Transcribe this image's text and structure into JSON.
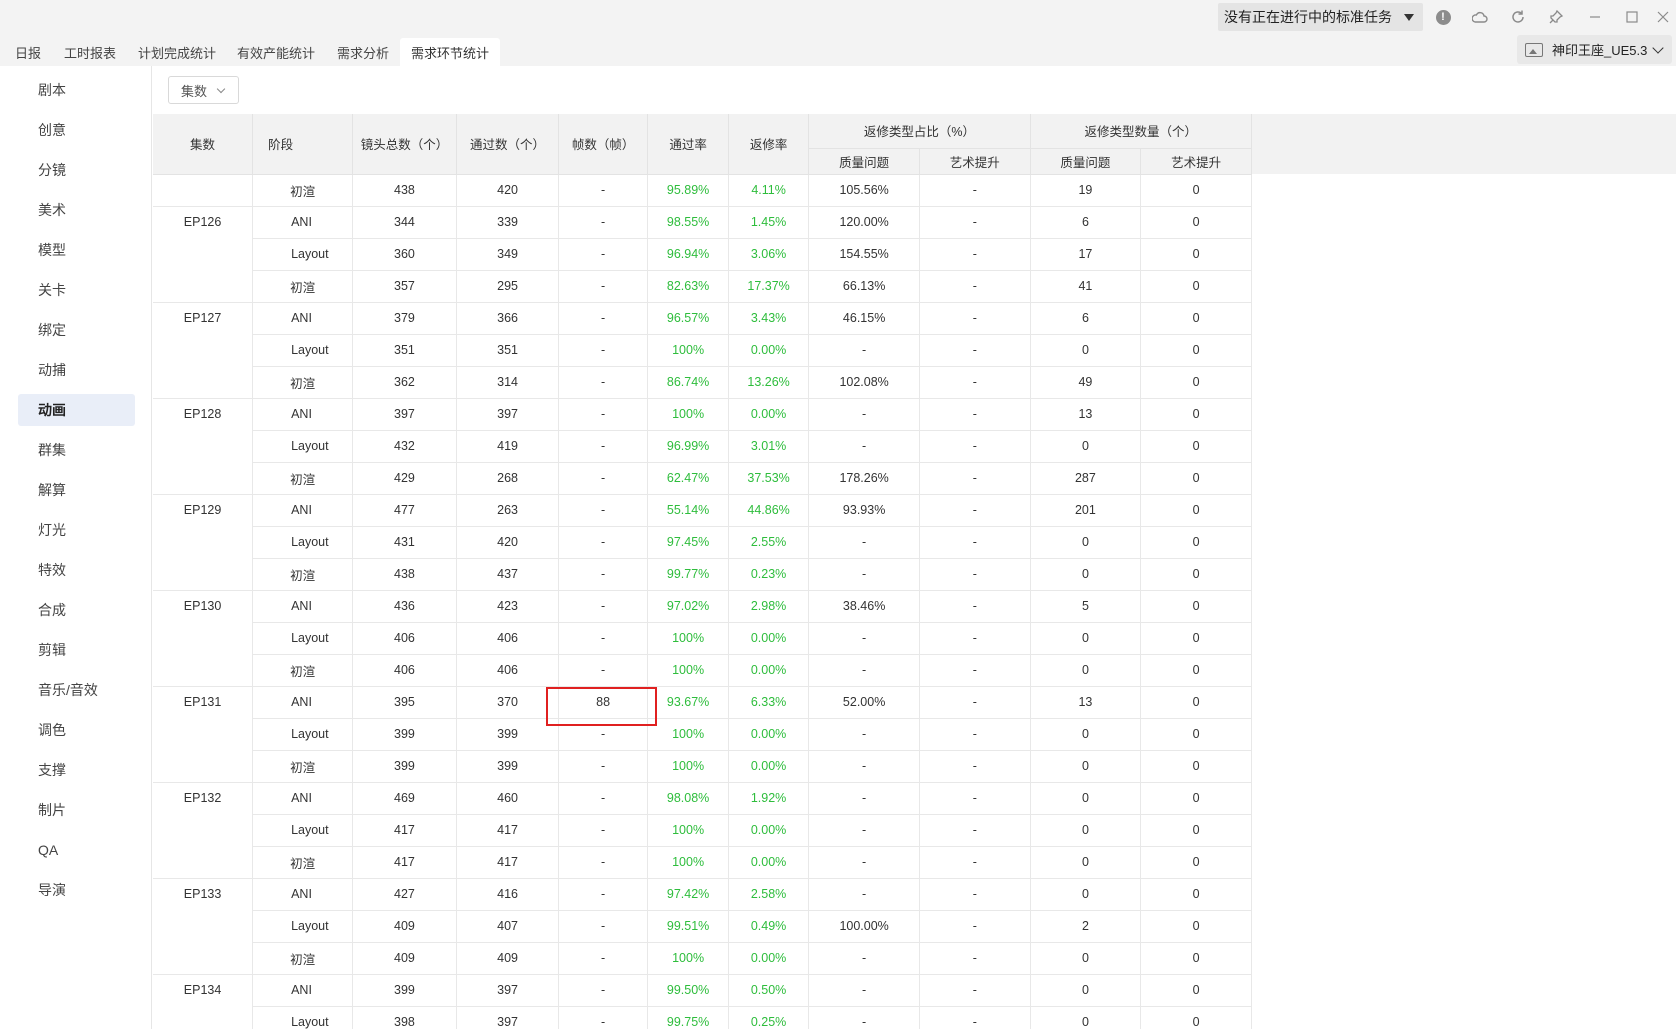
{
  "titlebar": {
    "task_dropdown": "没有正在进行中的标准任务"
  },
  "tabs": [
    {
      "label": "日报",
      "active": false
    },
    {
      "label": "工时报表",
      "active": false
    },
    {
      "label": "计划完成统计",
      "active": false
    },
    {
      "label": "有效产能统计",
      "active": false
    },
    {
      "label": "需求分析",
      "active": false
    },
    {
      "label": "需求环节统计",
      "active": true
    }
  ],
  "project": {
    "label": "神印王座_UE5.3"
  },
  "sidebar": {
    "items": [
      "剧本",
      "创意",
      "分镜",
      "美术",
      "模型",
      "关卡",
      "绑定",
      "动捕",
      "动画",
      "群集",
      "解算",
      "灯光",
      "特效",
      "合成",
      "剪辑",
      "音乐/音效",
      "调色",
      "支撑",
      "制片",
      "QA",
      "导演"
    ],
    "active": "动画"
  },
  "filter": {
    "label": "集数"
  },
  "table": {
    "headers": {
      "episode": "集数",
      "stage": "阶段",
      "total_shots": "镜头总数（个）",
      "passed": "通过数（个）",
      "frames": "帧数（帧）",
      "pass_rate": "通过率",
      "rework_rate": "返修率",
      "ratio_group": "返修类型占比（%）",
      "count_group": "返修类型数量（个）",
      "quality": "质量问题",
      "art": "艺术提升"
    },
    "rows": [
      {
        "ep": "",
        "stage": "初渲",
        "total": "438",
        "passed": "420",
        "frames": "-",
        "pass": "95.89%",
        "rework": "4.11%",
        "q_ratio": "105.56%",
        "a_ratio": "-",
        "q_cnt": "19",
        "a_cnt": "0"
      },
      {
        "ep": "EP126",
        "stage": "ANI",
        "total": "344",
        "passed": "339",
        "frames": "-",
        "pass": "98.55%",
        "rework": "1.45%",
        "q_ratio": "120.00%",
        "a_ratio": "-",
        "q_cnt": "6",
        "a_cnt": "0"
      },
      {
        "ep": "",
        "stage": "Layout",
        "total": "360",
        "passed": "349",
        "frames": "-",
        "pass": "96.94%",
        "rework": "3.06%",
        "q_ratio": "154.55%",
        "a_ratio": "-",
        "q_cnt": "17",
        "a_cnt": "0"
      },
      {
        "ep": "",
        "stage": "初渲",
        "total": "357",
        "passed": "295",
        "frames": "-",
        "pass": "82.63%",
        "rework": "17.37%",
        "q_ratio": "66.13%",
        "a_ratio": "-",
        "q_cnt": "41",
        "a_cnt": "0"
      },
      {
        "ep": "EP127",
        "stage": "ANI",
        "total": "379",
        "passed": "366",
        "frames": "-",
        "pass": "96.57%",
        "rework": "3.43%",
        "q_ratio": "46.15%",
        "a_ratio": "-",
        "q_cnt": "6",
        "a_cnt": "0"
      },
      {
        "ep": "",
        "stage": "Layout",
        "total": "351",
        "passed": "351",
        "frames": "-",
        "pass": "100%",
        "rework": "0.00%",
        "q_ratio": "-",
        "a_ratio": "-",
        "q_cnt": "0",
        "a_cnt": "0"
      },
      {
        "ep": "",
        "stage": "初渲",
        "total": "362",
        "passed": "314",
        "frames": "-",
        "pass": "86.74%",
        "rework": "13.26%",
        "q_ratio": "102.08%",
        "a_ratio": "-",
        "q_cnt": "49",
        "a_cnt": "0"
      },
      {
        "ep": "EP128",
        "stage": "ANI",
        "total": "397",
        "passed": "397",
        "frames": "-",
        "pass": "100%",
        "rework": "0.00%",
        "q_ratio": "-",
        "a_ratio": "-",
        "q_cnt": "13",
        "a_cnt": "0"
      },
      {
        "ep": "",
        "stage": "Layout",
        "total": "432",
        "passed": "419",
        "frames": "-",
        "pass": "96.99%",
        "rework": "3.01%",
        "q_ratio": "-",
        "a_ratio": "-",
        "q_cnt": "0",
        "a_cnt": "0"
      },
      {
        "ep": "",
        "stage": "初渲",
        "total": "429",
        "passed": "268",
        "frames": "-",
        "pass": "62.47%",
        "rework": "37.53%",
        "q_ratio": "178.26%",
        "a_ratio": "-",
        "q_cnt": "287",
        "a_cnt": "0"
      },
      {
        "ep": "EP129",
        "stage": "ANI",
        "total": "477",
        "passed": "263",
        "frames": "-",
        "pass": "55.14%",
        "rework": "44.86%",
        "q_ratio": "93.93%",
        "a_ratio": "-",
        "q_cnt": "201",
        "a_cnt": "0"
      },
      {
        "ep": "",
        "stage": "Layout",
        "total": "431",
        "passed": "420",
        "frames": "-",
        "pass": "97.45%",
        "rework": "2.55%",
        "q_ratio": "-",
        "a_ratio": "-",
        "q_cnt": "0",
        "a_cnt": "0"
      },
      {
        "ep": "",
        "stage": "初渲",
        "total": "438",
        "passed": "437",
        "frames": "-",
        "pass": "99.77%",
        "rework": "0.23%",
        "q_ratio": "-",
        "a_ratio": "-",
        "q_cnt": "0",
        "a_cnt": "0"
      },
      {
        "ep": "EP130",
        "stage": "ANI",
        "total": "436",
        "passed": "423",
        "frames": "-",
        "pass": "97.02%",
        "rework": "2.98%",
        "q_ratio": "38.46%",
        "a_ratio": "-",
        "q_cnt": "5",
        "a_cnt": "0"
      },
      {
        "ep": "",
        "stage": "Layout",
        "total": "406",
        "passed": "406",
        "frames": "-",
        "pass": "100%",
        "rework": "0.00%",
        "q_ratio": "-",
        "a_ratio": "-",
        "q_cnt": "0",
        "a_cnt": "0"
      },
      {
        "ep": "",
        "stage": "初渲",
        "total": "406",
        "passed": "406",
        "frames": "-",
        "pass": "100%",
        "rework": "0.00%",
        "q_ratio": "-",
        "a_ratio": "-",
        "q_cnt": "0",
        "a_cnt": "0"
      },
      {
        "ep": "EP131",
        "stage": "ANI",
        "total": "395",
        "passed": "370",
        "frames": "88",
        "pass": "93.67%",
        "rework": "6.33%",
        "q_ratio": "52.00%",
        "a_ratio": "-",
        "q_cnt": "13",
        "a_cnt": "0",
        "highlight": true
      },
      {
        "ep": "",
        "stage": "Layout",
        "total": "399",
        "passed": "399",
        "frames": "-",
        "pass": "100%",
        "rework": "0.00%",
        "q_ratio": "-",
        "a_ratio": "-",
        "q_cnt": "0",
        "a_cnt": "0"
      },
      {
        "ep": "",
        "stage": "初渲",
        "total": "399",
        "passed": "399",
        "frames": "-",
        "pass": "100%",
        "rework": "0.00%",
        "q_ratio": "-",
        "a_ratio": "-",
        "q_cnt": "0",
        "a_cnt": "0"
      },
      {
        "ep": "EP132",
        "stage": "ANI",
        "total": "469",
        "passed": "460",
        "frames": "-",
        "pass": "98.08%",
        "rework": "1.92%",
        "q_ratio": "-",
        "a_ratio": "-",
        "q_cnt": "0",
        "a_cnt": "0"
      },
      {
        "ep": "",
        "stage": "Layout",
        "total": "417",
        "passed": "417",
        "frames": "-",
        "pass": "100%",
        "rework": "0.00%",
        "q_ratio": "-",
        "a_ratio": "-",
        "q_cnt": "0",
        "a_cnt": "0"
      },
      {
        "ep": "",
        "stage": "初渲",
        "total": "417",
        "passed": "417",
        "frames": "-",
        "pass": "100%",
        "rework": "0.00%",
        "q_ratio": "-",
        "a_ratio": "-",
        "q_cnt": "0",
        "a_cnt": "0"
      },
      {
        "ep": "EP133",
        "stage": "ANI",
        "total": "427",
        "passed": "416",
        "frames": "-",
        "pass": "97.42%",
        "rework": "2.58%",
        "q_ratio": "-",
        "a_ratio": "-",
        "q_cnt": "0",
        "a_cnt": "0"
      },
      {
        "ep": "",
        "stage": "Layout",
        "total": "409",
        "passed": "407",
        "frames": "-",
        "pass": "99.51%",
        "rework": "0.49%",
        "q_ratio": "100.00%",
        "a_ratio": "-",
        "q_cnt": "2",
        "a_cnt": "0"
      },
      {
        "ep": "",
        "stage": "初渲",
        "total": "409",
        "passed": "409",
        "frames": "-",
        "pass": "100%",
        "rework": "0.00%",
        "q_ratio": "-",
        "a_ratio": "-",
        "q_cnt": "0",
        "a_cnt": "0"
      },
      {
        "ep": "EP134",
        "stage": "ANI",
        "total": "399",
        "passed": "397",
        "frames": "-",
        "pass": "99.50%",
        "rework": "0.50%",
        "q_ratio": "-",
        "a_ratio": "-",
        "q_cnt": "0",
        "a_cnt": "0"
      },
      {
        "ep": "",
        "stage": "Layout",
        "total": "398",
        "passed": "397",
        "frames": "-",
        "pass": "99.75%",
        "rework": "0.25%",
        "q_ratio": "-",
        "a_ratio": "-",
        "q_cnt": "0",
        "a_cnt": "0"
      }
    ]
  },
  "colors": {
    "accent_green": "#2ebd3c",
    "highlight_red": "#e02020",
    "active_side_bg": "#e9eef8"
  }
}
